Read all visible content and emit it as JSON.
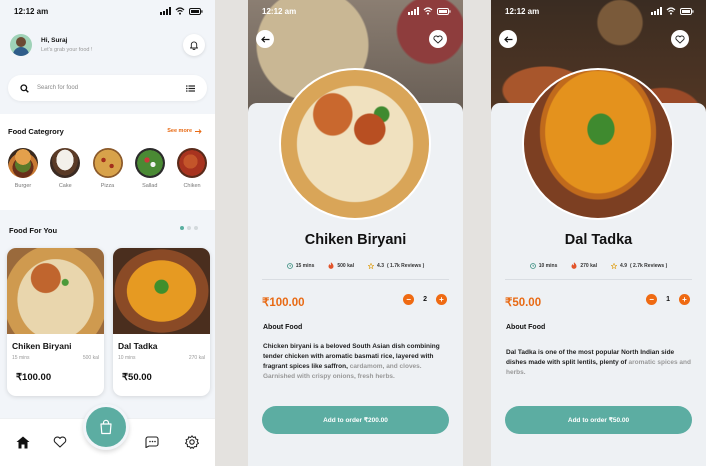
{
  "time": "12:12 am",
  "home": {
    "greeting": "Hi, Suraj",
    "subtitle": "Let's grab your food !",
    "search_placeholder": "Search for food",
    "category_title": "Food Categrory",
    "see_more": "See more",
    "categories": [
      {
        "label": "Burger",
        "icon": "burger-image"
      },
      {
        "label": "Cake",
        "icon": "cake-image"
      },
      {
        "label": "Pizza",
        "icon": "pizza-image"
      },
      {
        "label": "Sallad",
        "icon": "salad-image"
      },
      {
        "label": "Chiken",
        "icon": "chicken-image"
      }
    ],
    "food_for_you_title": "Food For You",
    "carousel_active_index": 0,
    "foods": [
      {
        "name": "Chiken Biryani",
        "time": "15 mins",
        "kcal": "500 kal",
        "price": "₹100.00"
      },
      {
        "name": "Dal Tadka",
        "time": "10 mins",
        "kcal": "270 kal",
        "price": "₹50.00"
      }
    ],
    "tabs": [
      "home-icon",
      "heart-icon",
      "bag-icon",
      "chat-icon",
      "settings-icon"
    ]
  },
  "biryani": {
    "title": "Chiken Biryani",
    "time": "15 mins",
    "kcal": "500 kal",
    "rating": "4.3",
    "reviews": "( 1.7k Reviews )",
    "price": "₹100.00",
    "qty": "2",
    "about_label": "About Food",
    "desc": "Chicken biryani is a beloved South Asian dish combining tender chicken with aromatic basmati rice, layered with fragrant spices like saffron,",
    "desc_fade": "cardamom, and cloves. Garnished with crispy onions, fresh herbs.",
    "order_label": "Add to order ₹200.00"
  },
  "dal": {
    "title": "Dal Tadka",
    "time": "10 mins",
    "kcal": "270 kal",
    "rating": "4.9",
    "reviews": "( 2.7k Reviews )",
    "price": "₹50.00",
    "qty": "1",
    "about_label": "About Food",
    "desc": "Dal Tadka is one of the most popular North Indian side dishes made with split lentils, plenty of",
    "desc_fade": "aromatic spices and herbs.",
    "order_label": "Add to order ₹50.00"
  },
  "colors": {
    "accent": "#5cada2",
    "orange": "#e86a14"
  }
}
